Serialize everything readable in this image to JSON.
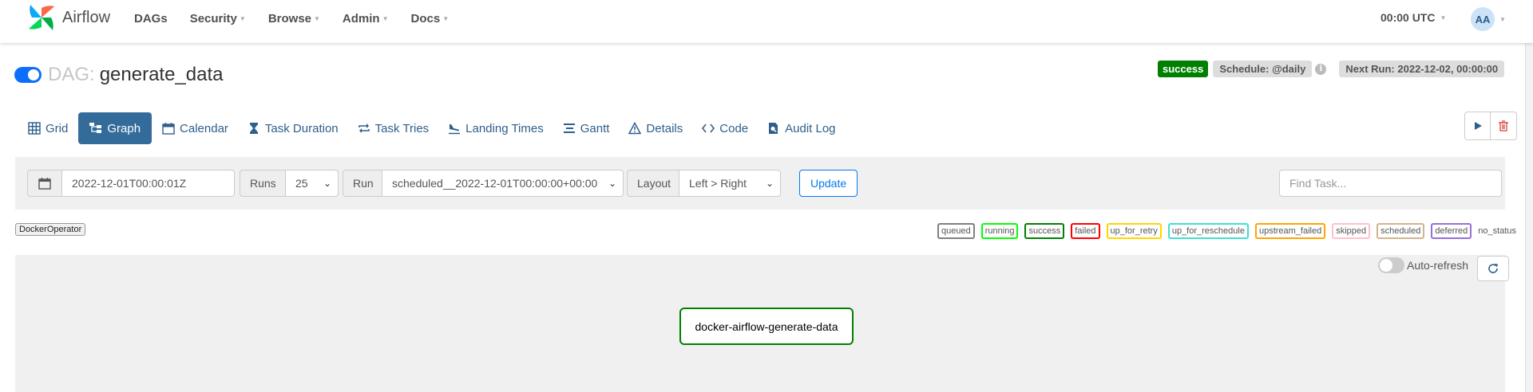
{
  "navbar": {
    "brand": "Airflow",
    "menu": [
      {
        "label": "DAGs",
        "dropdown": false
      },
      {
        "label": "Security",
        "dropdown": true
      },
      {
        "label": "Browse",
        "dropdown": true
      },
      {
        "label": "Admin",
        "dropdown": true
      },
      {
        "label": "Docs",
        "dropdown": true
      }
    ],
    "clock": "00:00 UTC",
    "user_initials": "AA"
  },
  "header": {
    "dag_prefix": "DAG:",
    "dag_id": "generate_data",
    "paused": false,
    "state_badge": "success",
    "schedule": "Schedule: @daily",
    "next_run": "Next Run: 2022-12-02, 00:00:00"
  },
  "tabs": [
    {
      "label": "Grid",
      "icon": "grid-icon"
    },
    {
      "label": "Graph",
      "icon": "graph-icon",
      "active": true
    },
    {
      "label": "Calendar",
      "icon": "calendar-icon"
    },
    {
      "label": "Task Duration",
      "icon": "hourglass-icon"
    },
    {
      "label": "Task Tries",
      "icon": "repeat-icon"
    },
    {
      "label": "Landing Times",
      "icon": "plane-landing-icon"
    },
    {
      "label": "Gantt",
      "icon": "gantt-icon"
    },
    {
      "label": "Details",
      "icon": "warning-triangle-icon"
    },
    {
      "label": "Code",
      "icon": "code-icon"
    },
    {
      "label": "Audit Log",
      "icon": "file-search-icon"
    }
  ],
  "filters": {
    "execution_date": "2022-12-01T00:00:01Z",
    "runs_label": "Runs",
    "runs_value": "25",
    "run_label": "Run",
    "run_value": "scheduled__2022-12-01T00:00:00+00:00",
    "layout_label": "Layout",
    "layout_value": "Left > Right",
    "update_label": "Update",
    "find_task_placeholder": "Find Task..."
  },
  "legend": {
    "operator": "DockerOperator",
    "states": [
      {
        "label": "queued",
        "color": "#808080"
      },
      {
        "label": "running",
        "color": "#00ff00"
      },
      {
        "label": "success",
        "color": "#008000"
      },
      {
        "label": "failed",
        "color": "#ff0000"
      },
      {
        "label": "up_for_retry",
        "color": "#ffd700"
      },
      {
        "label": "up_for_reschedule",
        "color": "#40e0d0"
      },
      {
        "label": "upstream_failed",
        "color": "#ffa500"
      },
      {
        "label": "skipped",
        "color": "#ffc0cb"
      },
      {
        "label": "scheduled",
        "color": "#d2b48c"
      },
      {
        "label": "deferred",
        "color": "#9370db"
      },
      {
        "label": "no_status",
        "color": null
      }
    ]
  },
  "graph": {
    "auto_refresh_label": "Auto-refresh",
    "auto_refresh_on": false,
    "task": {
      "id": "docker-airflow-generate-data",
      "state": "success"
    }
  },
  "colors": {
    "primary": "#336b9b",
    "link": "#2e5f8a",
    "success": "#008000",
    "toggle_on": "#0d6efd"
  }
}
